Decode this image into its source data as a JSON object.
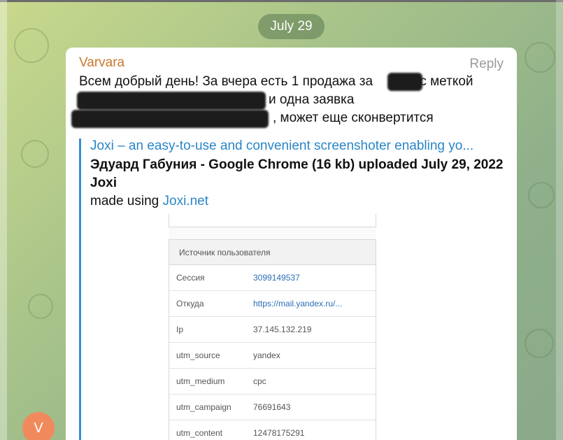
{
  "date_separator": "July 29",
  "message": {
    "sender": "Varvara",
    "reply_label": "Reply",
    "line1_start": "Всем добрый день! За вчера есть 1 продажа за ",
    "line1_end": "с меткой",
    "line2_end": "и одна заявка",
    "line3_end": ", может еще сконвертится"
  },
  "link_preview": {
    "title": "Joxi – an easy-to-use and convenient screenshoter enabling yo...",
    "description_line": "Эдуард Габуния - Google Chrome (16 kb) uploaded July 29, 2022",
    "site_name": "Joxi",
    "made_using_prefix": "made using ",
    "made_using_link": "Joxi.net",
    "screenshot": {
      "table_header": "Источник пользователя",
      "rows": [
        {
          "key": "Сессия",
          "value": "3099149537"
        },
        {
          "key": "Откуда",
          "value": "https://mail.yandex.ru/..."
        },
        {
          "key": "Ip",
          "value": "37.145.132.219"
        },
        {
          "key": "utm_source",
          "value": "yandex"
        },
        {
          "key": "utm_medium",
          "value": "cpc"
        },
        {
          "key": "utm_campaign",
          "value": "76691643"
        },
        {
          "key": "utm_content",
          "value": "12478175291"
        }
      ]
    }
  },
  "avatar_initial": "V",
  "colors": {
    "sender": "#c8782f",
    "link": "#2a86c7",
    "avatar": "#f08a5d"
  }
}
